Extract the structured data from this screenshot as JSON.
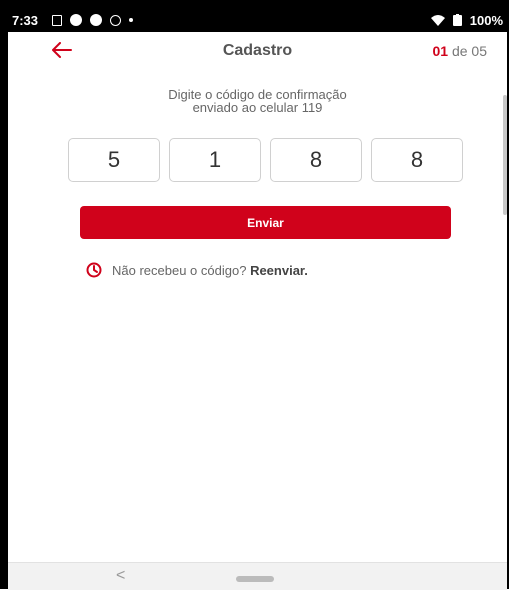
{
  "status_bar": {
    "time": "7:33",
    "battery": "100%"
  },
  "header": {
    "back_icon": "arrow-left-icon",
    "title": "Cadastro",
    "step_current": "01",
    "step_rest": " de 05"
  },
  "instructions": {
    "line1": "Digite o código de confirmação",
    "line2": "enviado ao celular 119"
  },
  "code": {
    "digits": [
      "5",
      "1",
      "8",
      "8"
    ]
  },
  "send_button": {
    "label": "Enviar"
  },
  "resend": {
    "icon": "clock-icon",
    "text": "Não recebeu o código?",
    "link": "Reenviar."
  },
  "nav_bar": {
    "back": "<"
  },
  "colors": {
    "accent": "#d0021b",
    "text": "#555555"
  }
}
